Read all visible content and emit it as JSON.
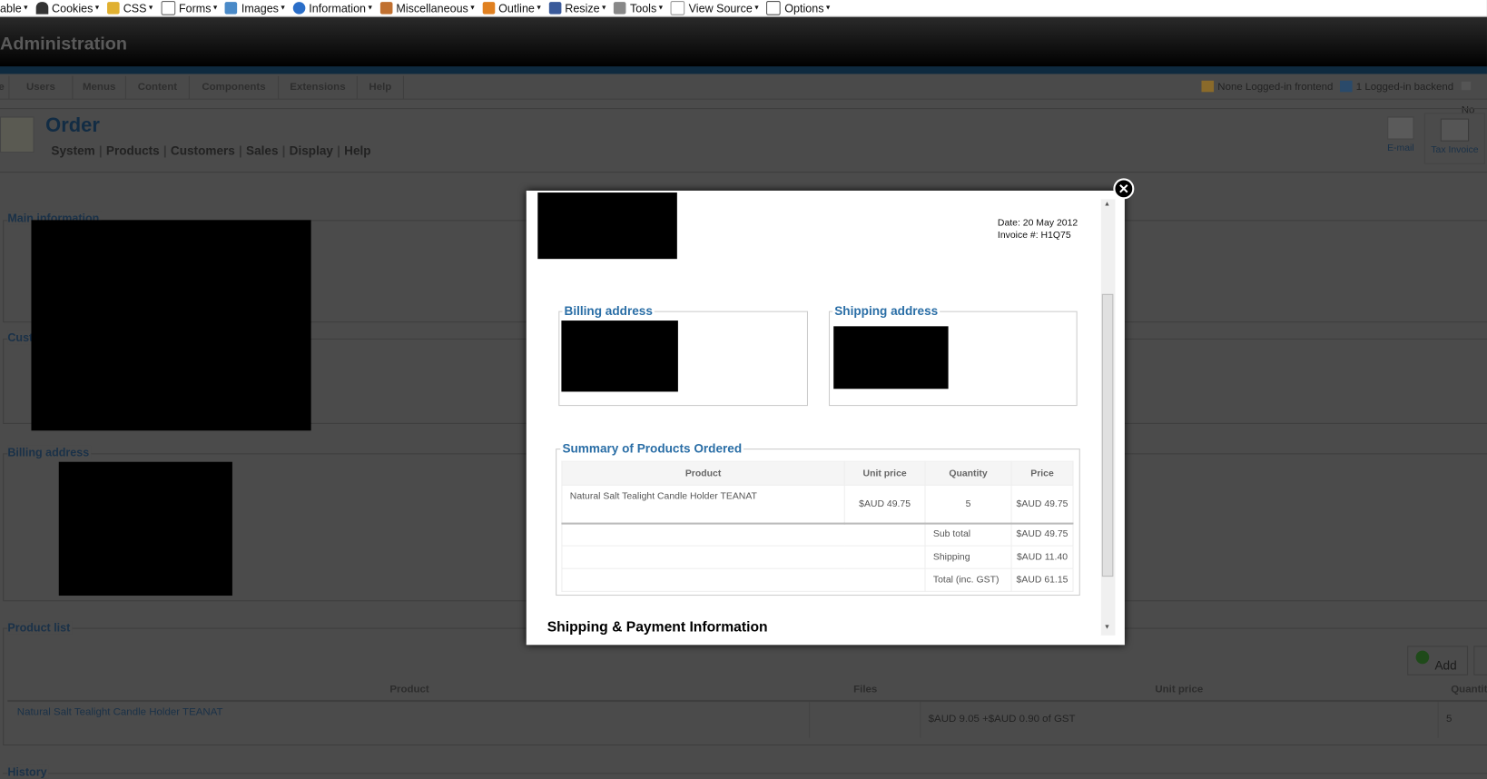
{
  "devbar": {
    "items": [
      "able",
      "Cookies",
      "CSS",
      "Forms",
      "Images",
      "Information",
      "Miscellaneous",
      "Outline",
      "Resize",
      "Tools",
      "View Source",
      "Options"
    ]
  },
  "header": {
    "title": "Administration"
  },
  "menu": {
    "items": [
      "e",
      "Users",
      "Menus",
      "Content",
      "Components",
      "Extensions",
      "Help"
    ],
    "status_frontend": "None Logged-in frontend",
    "status_backend": "1 Logged-in backend",
    "status_messages": "No"
  },
  "order": {
    "title": "Order",
    "subnav": [
      "System",
      "Products",
      "Customers",
      "Sales",
      "Display",
      "Help"
    ],
    "toolbar": {
      "email": "E-mail",
      "tax_invoice": "Tax Invoice",
      "add": "Add"
    }
  },
  "sections": {
    "main_info": "Main information",
    "customer": "Cust",
    "billing": "Billing address",
    "product_list": "Product list",
    "history": "History"
  },
  "product_list": {
    "headers": [
      "Product",
      "Files",
      "Unit price",
      "Quantit"
    ],
    "rows": [
      {
        "product": "Natural Salt Tealight Candle Holder TEANAT",
        "files": "",
        "unit_price": "$AUD 9.05 +$AUD 0.90 of GST",
        "quantity": "5"
      }
    ]
  },
  "invoice": {
    "date": "Date: 20 May 2012",
    "number": "Invoice #: H1Q75",
    "billing_title": "Billing address",
    "shipping_title": "Shipping address",
    "summary_title": "Summary of Products Ordered",
    "headers": [
      "Product",
      "Unit price",
      "Quantity",
      "Price"
    ],
    "items": [
      {
        "product": "Natural Salt Tealight Candle Holder TEANAT",
        "unit_price": "$AUD 49.75",
        "quantity": "5",
        "price": "$AUD 49.75"
      }
    ],
    "totals": [
      {
        "label": "Sub total",
        "value": "$AUD 49.75"
      },
      {
        "label": "Shipping",
        "value": "$AUD 11.40"
      },
      {
        "label": "Total (inc. GST)",
        "value": "$AUD 61.15"
      }
    ],
    "shipping_payment_title": "Shipping & Payment Information"
  },
  "colors": {
    "accent": "#2a6ea6",
    "overlay": "#4b4b4b"
  }
}
